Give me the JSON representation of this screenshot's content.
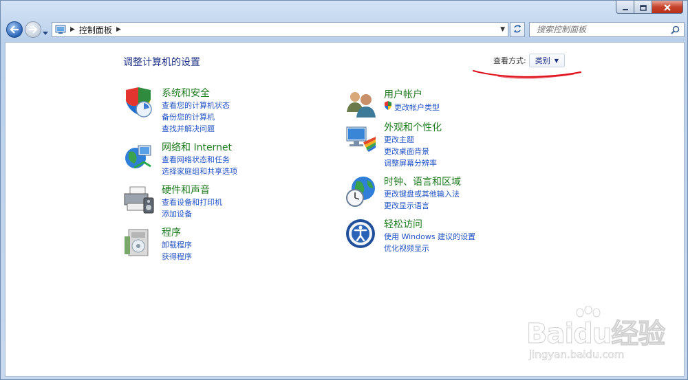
{
  "window": {
    "caption": {
      "minimize_icon": "minimize-icon",
      "maximize_icon": "maximize-icon",
      "close_icon": "close-icon"
    }
  },
  "nav": {
    "breadcrumb": "控制面板",
    "search_placeholder": "搜索控制面板"
  },
  "content": {
    "page_title": "调整计算机的设置",
    "view_by_label": "查看方式:",
    "view_by_value": "类别",
    "left_column": [
      {
        "title": "系统和安全",
        "icon": "system-security-icon",
        "links": [
          "查看您的计算机状态",
          "备份您的计算机",
          "查找并解决问题"
        ]
      },
      {
        "title": "网络和 Internet",
        "icon": "network-icon",
        "links": [
          "查看网络状态和任务",
          "选择家庭组和共享选项"
        ]
      },
      {
        "title": "硬件和声音",
        "icon": "hardware-sound-icon",
        "links": [
          "查看设备和打印机",
          "添加设备"
        ]
      },
      {
        "title": "程序",
        "icon": "programs-icon",
        "links": [
          "卸载程序",
          "获得程序"
        ]
      }
    ],
    "right_column": [
      {
        "title": "用户帐户",
        "icon": "user-accounts-icon",
        "links": [
          "更改帐户类型"
        ]
      },
      {
        "title": "外观和个性化",
        "icon": "appearance-icon",
        "links": [
          "更改主题",
          "更改桌面背景",
          "调整屏幕分辨率"
        ]
      },
      {
        "title": "时钟、语言和区域",
        "icon": "clock-region-icon",
        "links": [
          "更改键盘或其他输入法",
          "更改显示语言"
        ]
      },
      {
        "title": "轻松访问",
        "icon": "ease-of-access-icon",
        "links": [
          "使用 Windows 建议的设置",
          "优化视频显示"
        ]
      }
    ]
  },
  "watermark": {
    "main": "Baidu经验",
    "url": "jingyan.baidu.com"
  },
  "colors": {
    "title_green": "#1d7a1d",
    "link_blue": "#2253c4",
    "heading_blue": "#1e3287",
    "annotation_red": "#e0141e"
  }
}
